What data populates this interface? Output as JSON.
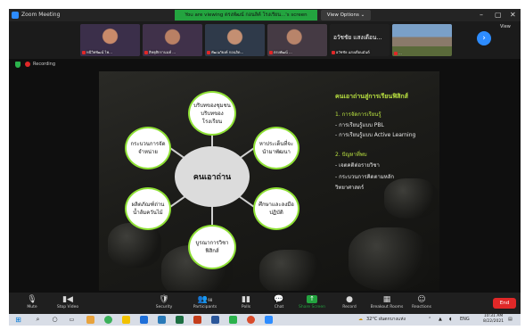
{
  "window": {
    "title": "Zoom Meeting",
    "viewing_banner": "You are viewing ตรงพัฒน์ กอนลิค์ โรงเรียน...'s screen",
    "view_options": "View Options ⌄",
    "controls": {
      "minimize": "–",
      "maximize": "▢",
      "close": "✕"
    }
  },
  "participants": [
    {
      "name": "หนีวิทพัฒน์ ไพ...",
      "tone": "#3b2f4a"
    },
    {
      "name": "สิทธุศิกรานนท์ ...",
      "tone": "#40314a"
    },
    {
      "name": "พัฒนภัยงค์ กอนลิด...",
      "tone": "#2f3a4a"
    },
    {
      "name": "ตรงพัฒน์ ...",
      "tone": "#453a44"
    },
    {
      "name": "อวัชชัย แสงเดือน...",
      "subname": "อวัชชัย แสงเดือนมันต์",
      "card": true
    },
    {
      "name": "...",
      "tone": "#4a5a6a"
    }
  ],
  "strip": {
    "next_icon": "›",
    "view_label": "View"
  },
  "status": {
    "recording_label": "Recording"
  },
  "slide": {
    "center": "คนเอาถ่าน",
    "nodes": [
      "บริบทของชุมชน บริบทของ โรงเรียน",
      "หาประเด็นที่จะ นำมาพัฒนา",
      "ศึกษาและลงมือ ปฏิบัติ",
      "บูรณาการวิชา ฟิสิกส์",
      "ผลิตภัณฑ์ถ่าน น้ำส้มควันไม้",
      "กระบวนการจัด จำหน่าย"
    ],
    "right": {
      "title": "คนเอาถ่านสู่การเรียนฟิสิกส์",
      "h1": "1. การจัดการเรียนรู้",
      "h1_items": [
        "- การเรียนรู้แบบ PBL",
        "- การเรียนรู้แบบ Active Learning"
      ],
      "h2": "2. ปัญหาที่พบ",
      "h2_items": [
        "- เจตคติต่อรายวิชา",
        "- กระบวนการคิดตามหลัก",
        "วิทยาศาสตร์"
      ]
    }
  },
  "toolbar": {
    "items": [
      {
        "label": "Mute",
        "icon": "🎙"
      },
      {
        "label": "Stop Video",
        "icon": "▮◀"
      },
      {
        "label": "Security",
        "icon": "🛡"
      },
      {
        "label": "Participants",
        "icon": "👥",
        "badge": "98"
      },
      {
        "label": "Polls",
        "icon": "▮▮"
      },
      {
        "label": "Chat",
        "icon": "💬"
      },
      {
        "label": "Share Screen",
        "icon": "↑"
      },
      {
        "label": "Record",
        "icon": "●"
      },
      {
        "label": "Breakout Rooms",
        "icon": "▦"
      },
      {
        "label": "Reactions",
        "icon": "☺"
      }
    ],
    "end_label": "End"
  },
  "taskbar": {
    "weather": "32°C ฝนตกบางแห่ง",
    "lang": "ENG",
    "time": "10:31 AM",
    "date": "8/22/2021"
  }
}
